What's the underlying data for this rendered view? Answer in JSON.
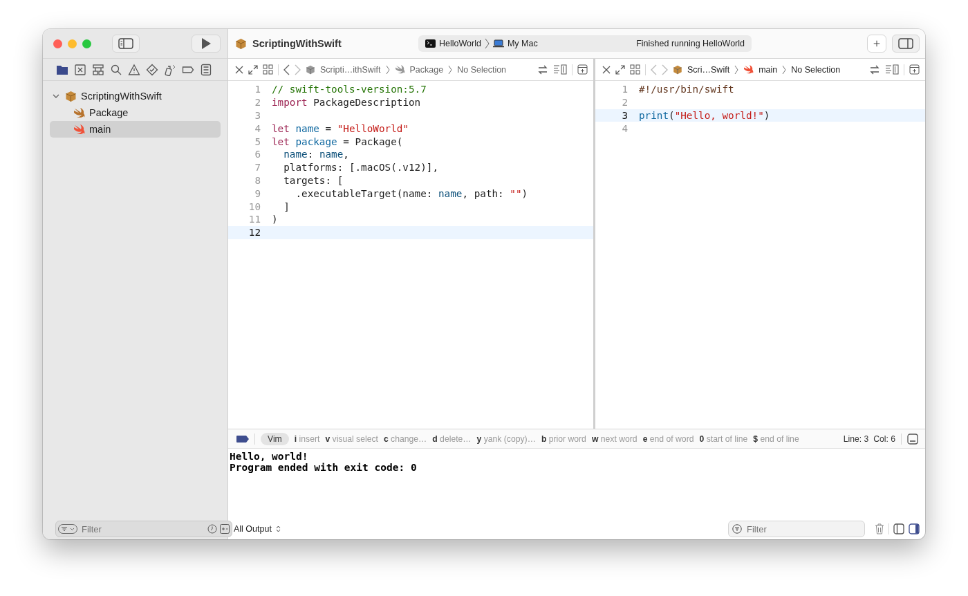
{
  "window": {
    "title": "ScriptingWithSwift"
  },
  "scheme": {
    "target": "HelloWorld",
    "destination": "My Mac",
    "status": "Finished running HelloWorld"
  },
  "sidebar": {
    "tree": [
      {
        "label": "ScriptingWithSwift",
        "kind": "package",
        "expanded": true,
        "selected": false,
        "children": [
          {
            "label": "Package",
            "kind": "swift-gray",
            "selected": false
          },
          {
            "label": "main",
            "kind": "swift",
            "selected": true
          }
        ]
      }
    ],
    "filter": {
      "placeholder": "Filter"
    }
  },
  "editors": [
    {
      "active": false,
      "breadcrumbs": [
        {
          "kind": "package",
          "text": "Scripti…ithSwift"
        },
        {
          "kind": "swift-gray",
          "text": "Package"
        },
        {
          "kind": "none",
          "text": "No Selection"
        }
      ],
      "lines": [
        {
          "number": "1",
          "selected": false,
          "tokens": [
            {
              "kind": "comment",
              "text": "// swift-tools-version:5.7"
            }
          ]
        },
        {
          "number": "2",
          "selected": false,
          "tokens": [
            {
              "kind": "keyword",
              "text": "import"
            },
            {
              "kind": "plain",
              "text": " PackageDescription"
            }
          ]
        },
        {
          "number": "3",
          "selected": false
        },
        {
          "number": "4",
          "selected": false,
          "tokens": [
            {
              "kind": "keyword",
              "text": "let"
            },
            {
              "kind": "decl",
              "text": " name"
            },
            {
              "kind": "plain",
              "text": " = "
            },
            {
              "kind": "string",
              "text": "\"HelloWorld\""
            }
          ]
        },
        {
          "number": "5",
          "selected": false,
          "tokens": [
            {
              "kind": "keyword",
              "text": "let"
            },
            {
              "kind": "decl",
              "text": " package"
            },
            {
              "kind": "plain",
              "text": " = Package("
            }
          ]
        },
        {
          "number": "6",
          "selected": false,
          "tokens": [
            {
              "kind": "ident",
              "text": "  name"
            },
            {
              "kind": "plain",
              "text": ": "
            },
            {
              "kind": "ident",
              "text": "name"
            },
            {
              "kind": "plain",
              "text": ","
            }
          ]
        },
        {
          "number": "7",
          "selected": false,
          "tokens": [
            {
              "kind": "plain",
              "text": "  platforms: [.macOS(.v12)],"
            }
          ]
        },
        {
          "number": "8",
          "selected": false,
          "tokens": [
            {
              "kind": "plain",
              "text": "  targets: ["
            }
          ]
        },
        {
          "number": "9",
          "selected": false,
          "tokens": [
            {
              "kind": "plain",
              "text": "    .executableTarget(name: "
            },
            {
              "kind": "ident",
              "text": "name"
            },
            {
              "kind": "plain",
              "text": ", path: "
            },
            {
              "kind": "string",
              "text": "\"\""
            },
            {
              "kind": "plain",
              "text": ")"
            }
          ]
        },
        {
          "number": "10",
          "selected": false,
          "tokens": [
            {
              "kind": "plain",
              "text": "  ]"
            }
          ]
        },
        {
          "number": "11",
          "selected": false,
          "tokens": [
            {
              "kind": "plain",
              "text": ")"
            }
          ]
        },
        {
          "number": "12",
          "selected": true
        }
      ]
    },
    {
      "active": true,
      "breadcrumbs": [
        {
          "kind": "package",
          "text": "Scri…Swift"
        },
        {
          "kind": "swift",
          "text": "main"
        },
        {
          "kind": "none",
          "text": "No Selection"
        }
      ],
      "lines": [
        {
          "number": "1",
          "selected": false,
          "tokens": [
            {
              "kind": "preproc",
              "text": "#!/usr/bin/swift"
            }
          ]
        },
        {
          "number": "2",
          "selected": false
        },
        {
          "number": "3",
          "selected": true,
          "tokens": [
            {
              "kind": "decl",
              "text": "print"
            },
            {
              "kind": "plain",
              "text": "("
            },
            {
              "kind": "string",
              "text": "\"Hello, world!\""
            },
            {
              "kind": "plain",
              "text": ")"
            }
          ]
        },
        {
          "number": "4",
          "selected": false
        }
      ]
    }
  ],
  "debug_bar": {
    "mode": "Vim",
    "hints": [
      {
        "key": "i",
        "label": "insert"
      },
      {
        "key": "v",
        "label": "visual select"
      },
      {
        "key": "c",
        "label": "change…"
      },
      {
        "key": "d",
        "label": "delete…"
      },
      {
        "key": "y",
        "label": "yank (copy)…"
      },
      {
        "key": "b",
        "label": "prior word"
      },
      {
        "key": "w",
        "label": "next word"
      },
      {
        "key": "e",
        "label": "end of word"
      },
      {
        "key": "0",
        "label": "start of line"
      },
      {
        "key": "$",
        "label": "end of line"
      }
    ],
    "position": "Line: 3  Col: 6"
  },
  "console": {
    "lines": [
      "Hello, world!",
      "Program ended with exit code: 0"
    ],
    "output_menu": "All Output",
    "filter": {
      "placeholder": "Filter"
    }
  }
}
